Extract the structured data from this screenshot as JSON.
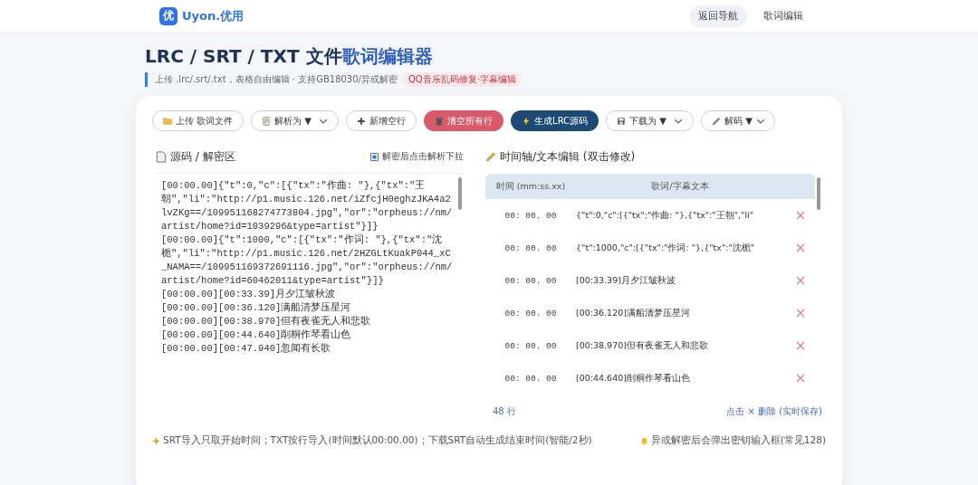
{
  "header": {
    "logo_mark": "优",
    "brand": "Uyon.优用",
    "nav": [
      {
        "label": "返回导航",
        "selected": true
      },
      {
        "label": "歌词编辑",
        "selected": false
      }
    ]
  },
  "page": {
    "title_plain": "LRC / SRT / TXT 文件",
    "title_accent": "歌词编辑器",
    "subtitle": "上传 .lrc/.srt/.txt，表格自由编辑 · 支持GB18030/异或解密",
    "tag": "QQ音乐乱码修复·字幕编辑"
  },
  "toolbar": [
    {
      "kind": "upload",
      "label": "上传 歌词文件"
    },
    {
      "kind": "parse",
      "label": "解析为 ▼"
    },
    {
      "kind": "add",
      "label": "新增空行"
    },
    {
      "kind": "clear",
      "label": "清空所有行"
    },
    {
      "kind": "generate",
      "label": "生成LRC源码"
    },
    {
      "kind": "download",
      "label": "下载为 ▼"
    },
    {
      "kind": "decode",
      "label": "解码 ▼"
    }
  ],
  "source": {
    "title": "源码 / 解密区",
    "option": {
      "label": "解密后点击解析下拉",
      "checked": true
    },
    "lines": [
      "[00:00.00]{\"t\":0,\"c\":[{\"tx\":\"作曲: \"},{\"tx\":\"王朝\",\"li\":\"http://p1.music.126.net/iZfcjH0eghzJKA4a2lvZKg==/109951168274773804.jpg\",\"or\":\"orpheus://nm/artist/home?id=1039296&type=artist\"}]}",
      "[00:00.00]{\"t\":1000,\"c\":[{\"tx\":\"作词: \"},{\"tx\":\"沈栀\",\"li\":\"http://p1.music.126.net/2HZGLtKuakP044_xC_NAMA==/109951169372691116.jpg\",\"or\":\"orpheus://nm/artist/home?id=60462011&type=artist\"}]}",
      "[00:00.00][00:33.39]月夕江皱秋波",
      "[00:00.00][00:36.120]满船清梦压星河",
      "[00:00.00][00:38.970]但有夜雀无人和悲歌",
      "[00:00.00][00:44.640]削桐作琴看山色",
      "[00:00.00][00:47.940]忽闻有长歌"
    ]
  },
  "editor": {
    "title": "时间轴/文本编辑 (双击修改)",
    "columns": [
      "时间 (mm:ss.xx)",
      "歌词/字幕文本"
    ],
    "rows": [
      {
        "time": "00: 00. 00",
        "text": "{\"t\":0,\"c\":[{\"tx\":\"作曲: \"},{\"tx\":\"王朝\",\"li\""
      },
      {
        "time": "00: 00. 00",
        "text": "{\"t\":1000,\"c\":[{\"tx\":\"作词: \"},{\"tx\":\"沈栀\""
      },
      {
        "time": "00: 00. 00",
        "text": "[00:33.39]月夕江皱秋波"
      },
      {
        "time": "00: 00. 00",
        "text": "[00:36.120]满船清梦压星河"
      },
      {
        "time": "00: 00. 00",
        "text": "[00:38.970]但有夜雀无人和悲歌"
      },
      {
        "time": "00: 00. 00",
        "text": "[00:44.640]削桐作琴看山色"
      }
    ],
    "count": "48 行",
    "hint": "点击 × 删除 (实时保存)"
  },
  "notes": {
    "left": "SRT导入只取开始时间；TXT按行导入(时间默认00:00.00)；下载SRT自动生成结束时间(智能/2秒)",
    "right": "异或解密后会弹出密钥输入框(常见128)"
  }
}
